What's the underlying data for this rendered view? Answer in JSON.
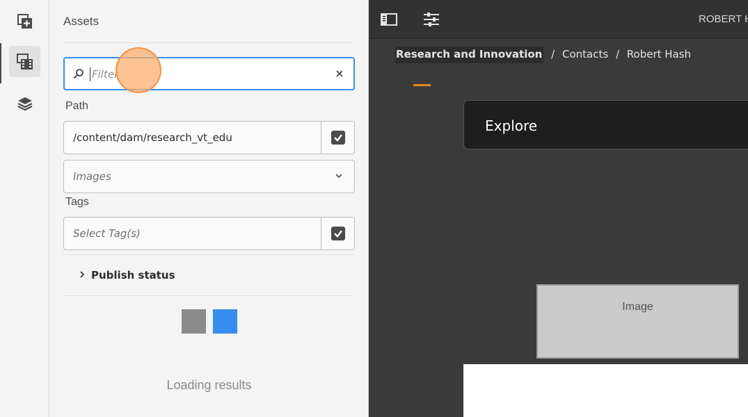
{
  "rail": {
    "items": [
      {
        "icon": "add-component-icon"
      },
      {
        "icon": "assets-icon"
      },
      {
        "icon": "layers-icon"
      }
    ]
  },
  "panel": {
    "title": "Assets",
    "filter": {
      "placeholder": "Filter"
    },
    "path": {
      "label": "Path",
      "value": "/content/dam/research_vt_edu"
    },
    "type_select": {
      "value": "Images"
    },
    "tags": {
      "label": "Tags",
      "placeholder": "Select Tag(s)"
    },
    "publish_status": "Publish status",
    "loading": "Loading results"
  },
  "editor": {
    "user": "ROBERT HA",
    "breadcrumb": [
      "Research and Innovation",
      "Contacts",
      "Robert Hash"
    ],
    "breadcrumb_sep": "/",
    "explore_title": "Explore",
    "image_placeholder": "Image"
  },
  "colors": {
    "accent": "#378ef0",
    "orange": "#e68619",
    "loader_gray": "#8a8a8a"
  }
}
